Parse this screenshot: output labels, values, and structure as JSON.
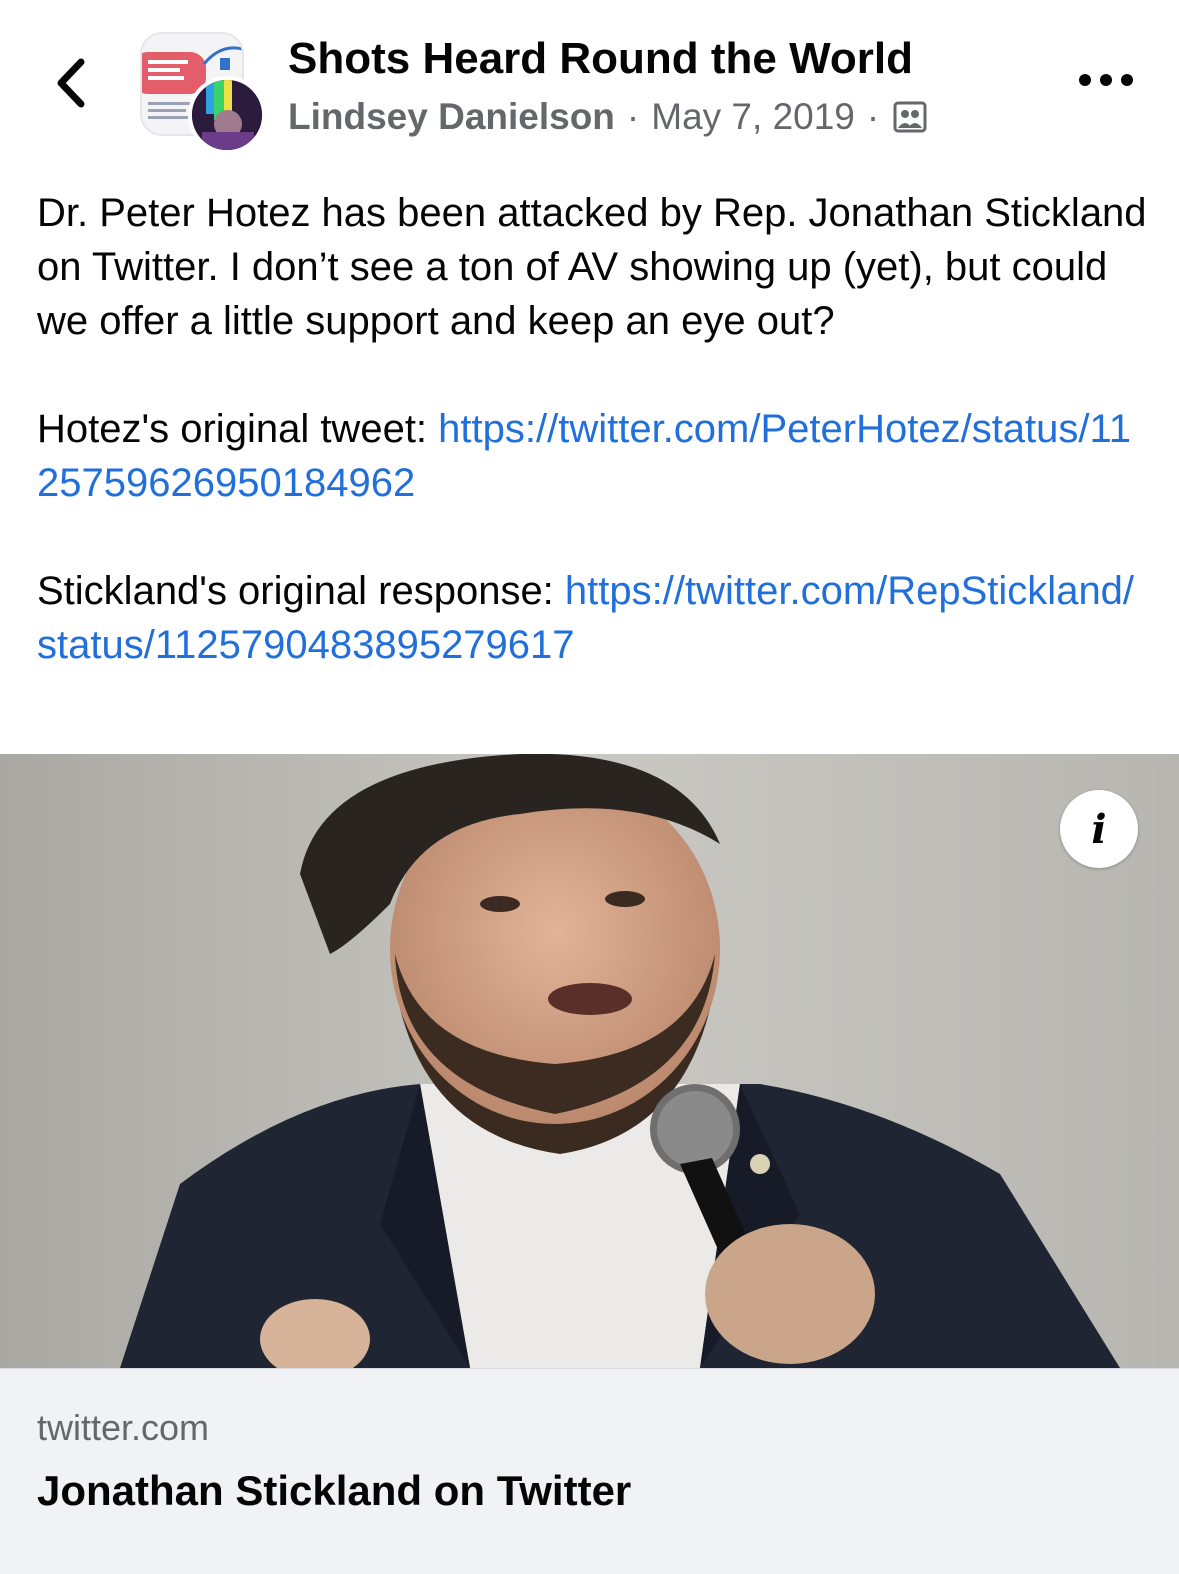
{
  "header": {
    "group_name": "Shots Heard Round the World",
    "author": "Lindsey Danielson",
    "separator": "·",
    "date": "May 7, 2019",
    "audience_icon": "group-audience-icon",
    "back_icon": "chevron-left-icon",
    "more_icon": "more-dots-icon"
  },
  "post": {
    "paragraph1": "Dr. Peter Hotez has been attacked by Rep. Jonathan Stickland on Twitter. I don’t see a ton of AV showing up (yet), but could we offer a little support and keep an eye out?",
    "tweet_label": "Hotez's original tweet: ",
    "tweet_link": "https://twitter.com/PeterHotez/status/1125759626950184962",
    "response_label": "Stickland's original response: ",
    "response_link": "https://twitter.com/RepStickland/status/1125790483895279617"
  },
  "link_preview": {
    "domain": "twitter.com",
    "title": "Jonathan Stickland on Twitter",
    "info_icon": "info-icon"
  },
  "colors": {
    "link": "#216fdb",
    "secondary_text": "#65676b",
    "card_bg": "#f0f2f5"
  }
}
